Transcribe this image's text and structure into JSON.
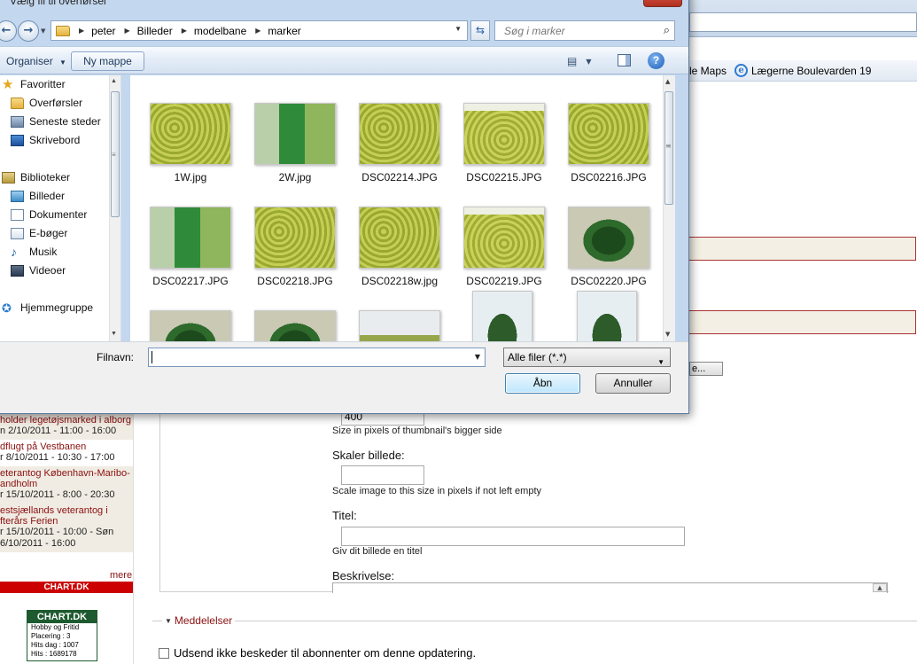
{
  "dialog": {
    "title": "Vælg fil til overførsel",
    "close_label": "x",
    "nav": {
      "back": "←",
      "forward": "→"
    },
    "breadcrumb": [
      "peter",
      "Billeder",
      "modelbane",
      "marker"
    ],
    "search_placeholder": "Søg i marker",
    "toolbar": {
      "organize": "Organiser",
      "new_folder": "Ny mappe"
    },
    "nav_pane": {
      "favorites": {
        "header": "Favoritter",
        "items": [
          "Overførsler",
          "Seneste steder",
          "Skrivebord"
        ]
      },
      "libraries": {
        "header": "Biblioteker",
        "items": [
          "Billeder",
          "Dokumenter",
          "E-bøger",
          "Musik",
          "Videoer"
        ]
      },
      "homegroup": "Hjemmegruppe"
    },
    "files": [
      "1W.jpg",
      "2W.jpg",
      "DSC02214.JPG",
      "DSC02215.JPG",
      "DSC02216.JPG",
      "DSC02217.JPG",
      "DSC02218.JPG",
      "DSC02218w.jpg",
      "DSC02219.JPG",
      "DSC02220.JPG"
    ],
    "filename_label": "Filnavn:",
    "filename_value": "",
    "filetype_selected": "Alle filer (*.*)",
    "open_button": "Åbn",
    "cancel_button": "Annuller"
  },
  "background": {
    "favbar": {
      "maps": "le Maps",
      "laegerne": "Lægerne Boulevarden 19"
    },
    "events": [
      {
        "title": "holder legetøjsmarked i alborg",
        "date": "n 2/10/2011 - 11:00 - 16:00"
      },
      {
        "title": "dflugt på Vestbanen",
        "date": "r 8/10/2011 - 10:30 - 17:00"
      },
      {
        "title": "eterantog København-Maribo-andholm",
        "date": "r 15/10/2011 - 8:00 - 20:30"
      },
      {
        "title": "estsjællands veterantog i fterårs Ferien",
        "date": "r 15/10/2011 - 10:00 - Søn 6/10/2011 - 16:00"
      }
    ],
    "more": "mere",
    "chart_bar": "CHART.DK",
    "badge": {
      "title": "CHART.DK",
      "lines": [
        "Hobby og Fritid",
        "Placering : 3",
        "Hits dag : 1007",
        "Hits : 1689178"
      ]
    },
    "browse_button": "e...",
    "thumb_value": "400",
    "thumb_hint": "Size in pixels of thumbnail's bigger side",
    "scale_label": "Skaler billede:",
    "scale_hint": "Scale image to this size in pixels if not left empty",
    "title_label": "Titel:",
    "title_hint": "Giv dit billede en titel",
    "desc_label": "Beskrivelse:",
    "messages_legend": "Meddelelser",
    "notify_checkbox": "Udsend ikke beskeder til abonnenter om denne opdatering."
  }
}
